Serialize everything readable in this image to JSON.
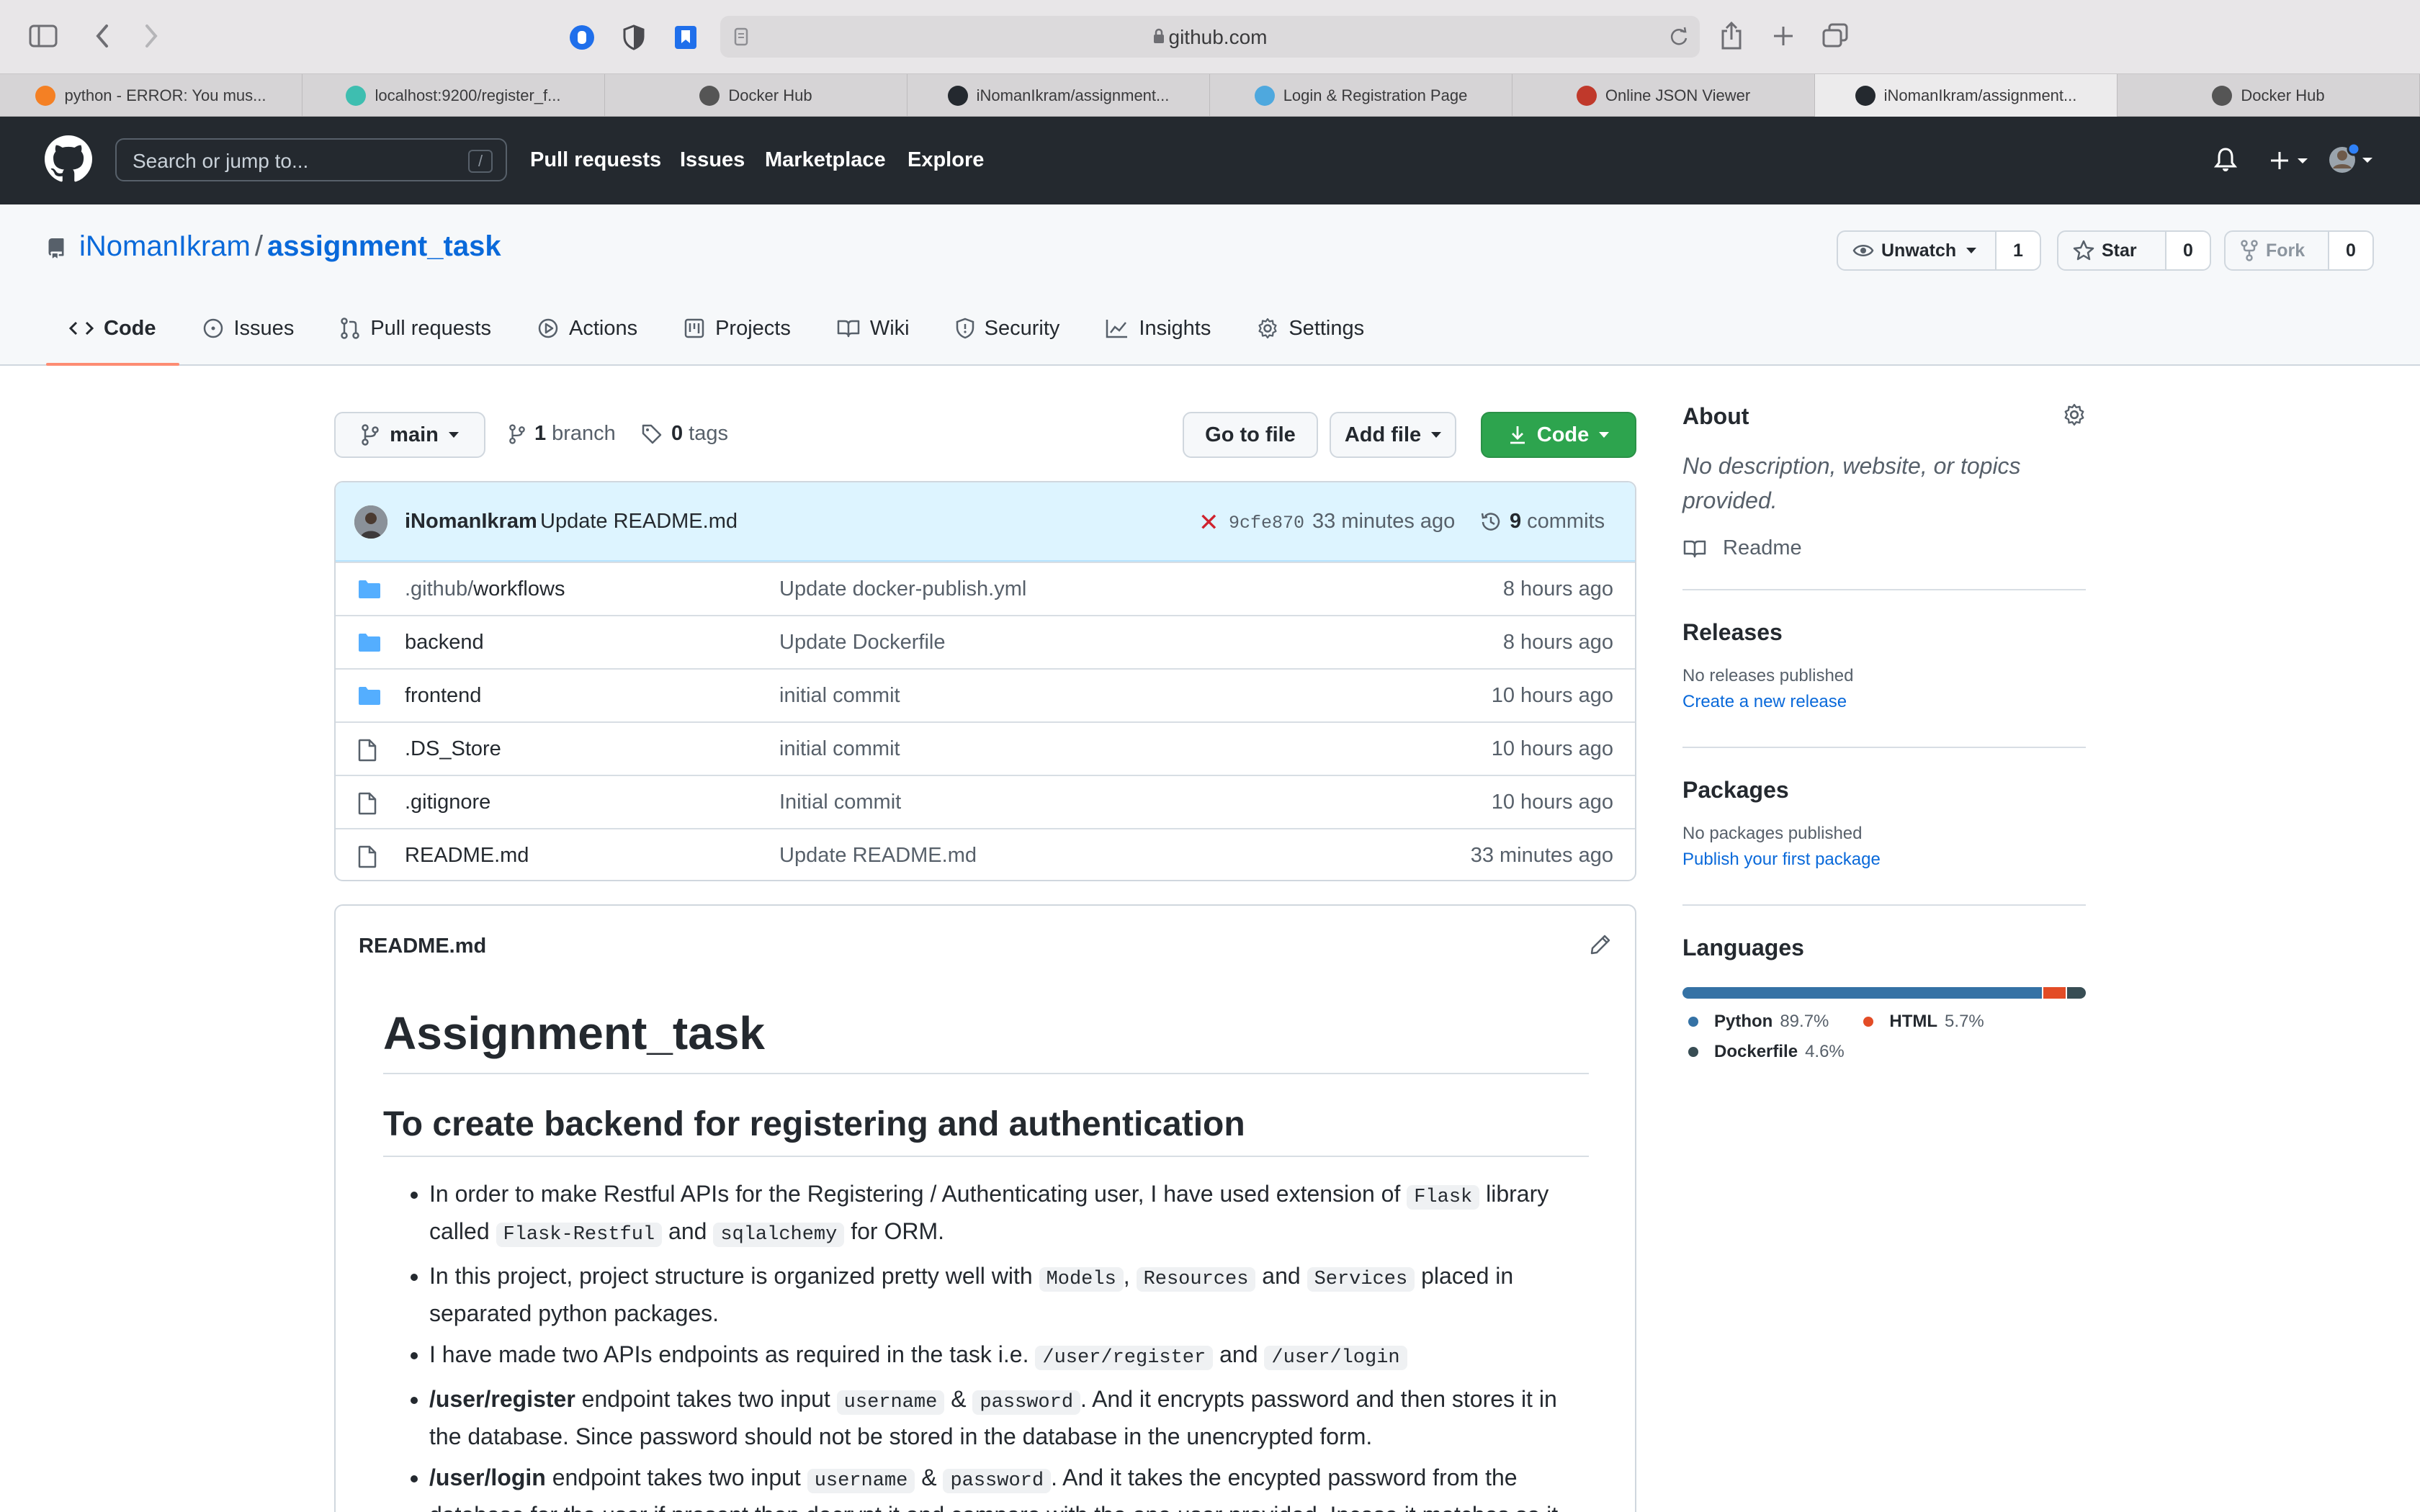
{
  "browser": {
    "url": "github.com",
    "tabs": [
      {
        "label": "python - ERROR: You mus...",
        "favicon_color": "#f48024"
      },
      {
        "label": "localhost:9200/register_f...",
        "favicon_color": "#3ebeb0"
      },
      {
        "label": "Docker Hub",
        "favicon_color": "#555555"
      },
      {
        "label": "iNomanIkram/assignment...",
        "favicon_color": "#24292f"
      },
      {
        "label": "Login & Registration Page",
        "favicon_color": "#4ea8de"
      },
      {
        "label": "Online JSON Viewer",
        "favicon_color": "#c0392b"
      },
      {
        "label": "iNomanIkram/assignment...",
        "favicon_color": "#24292f",
        "active": true
      },
      {
        "label": "Docker Hub",
        "favicon_color": "#555555"
      }
    ]
  },
  "github": {
    "search_placeholder": "Search or jump to...",
    "slash_key": "/",
    "nav": [
      "Pull requests",
      "Issues",
      "Marketplace",
      "Explore"
    ]
  },
  "repo": {
    "owner": "iNomanIkram",
    "separator": "/",
    "name": "assignment_task",
    "unwatch_label": "Unwatch",
    "watch_count": "1",
    "star_label": "Star",
    "star_count": "0",
    "fork_label": "Fork",
    "fork_count": "0",
    "tabs": [
      "Code",
      "Issues",
      "Pull requests",
      "Actions",
      "Projects",
      "Wiki",
      "Security",
      "Insights",
      "Settings"
    ]
  },
  "toolbar": {
    "branch": "main",
    "branch_count": "1",
    "branch_label": "branch",
    "tag_count": "0",
    "tag_label": "tags",
    "go_to_file": "Go to file",
    "add_file": "Add file",
    "code": "Code"
  },
  "commit": {
    "author": "iNomanIkram",
    "message": "Update README.md",
    "status": "✕",
    "sha": "9cfe870",
    "time": "33 minutes ago",
    "count": "9",
    "count_label": "commits"
  },
  "files": [
    {
      "type": "dir",
      "prefix": ".github/",
      "name": "workflows",
      "message": "Update docker-publish.yml",
      "time": "8 hours ago"
    },
    {
      "type": "dir",
      "prefix": "",
      "name": "backend",
      "message": "Update Dockerfile",
      "time": "8 hours ago"
    },
    {
      "type": "dir",
      "prefix": "",
      "name": "frontend",
      "message": "initial commit",
      "time": "10 hours ago"
    },
    {
      "type": "file",
      "prefix": "",
      "name": ".DS_Store",
      "message": "initial commit",
      "time": "10 hours ago"
    },
    {
      "type": "file",
      "prefix": "",
      "name": ".gitignore",
      "message": "Initial commit",
      "time": "10 hours ago"
    },
    {
      "type": "file",
      "prefix": "",
      "name": "README.md",
      "message": "Update README.md",
      "time": "33 minutes ago"
    }
  ],
  "readme": {
    "filename": "README.md",
    "h1": "Assignment_task",
    "h2": "To create backend for registering and authentication",
    "b1": {
      "t1": "In order to make Restful APIs for the Registering / Authenticating user, I have used extension of ",
      "c1": "Flask",
      "t2": " library called ",
      "c2": "Flask-Restful",
      "t3": " and ",
      "c3": "sqlalchemy",
      "t4": " for ORM."
    },
    "b2": {
      "t1": "In this project, project structure is organized pretty well with ",
      "c1": "Models",
      "t2": ", ",
      "c2": "Resources",
      "t3": " and ",
      "c3": "Services",
      "t4": " placed in separated python packages."
    },
    "b3": {
      "t1": "I have made two APIs endpoints as required in the task i.e. ",
      "c1": "/user/register",
      "t2": " and ",
      "c2": "/user/login"
    },
    "b4": {
      "strong": "/user/register",
      "t1": " endpoint takes two input ",
      "c1": "username",
      "t2": " & ",
      "c2": "password",
      "t3": ". And it encrypts password and then stores it in the database. Since password should not be stored in the database in the unencrypted form."
    },
    "b5": {
      "strong": "/user/login",
      "t1": " endpoint takes two input ",
      "c1": "username",
      "t2": " & ",
      "c2": "password",
      "t3": ". And it takes the encypted password from the database for the user if present then decrypt it and compare with the one user provided. Incase it matches so it"
    }
  },
  "sidebar": {
    "about_title": "About",
    "about_desc": "No description, website, or topics provided.",
    "readme_link": "Readme",
    "releases_title": "Releases",
    "releases_none": "No releases published",
    "releases_link": "Create a new release",
    "packages_title": "Packages",
    "packages_none": "No packages published",
    "packages_link": "Publish your first package",
    "languages_title": "Languages",
    "languages": [
      {
        "name": "Python",
        "percent": "89.7%",
        "value": 89.7,
        "color": "#3572A5"
      },
      {
        "name": "HTML",
        "percent": "5.7%",
        "value": 5.7,
        "color": "#e34c26"
      },
      {
        "name": "Dockerfile",
        "percent": "4.6%",
        "value": 4.6,
        "color": "#384d54"
      }
    ]
  }
}
